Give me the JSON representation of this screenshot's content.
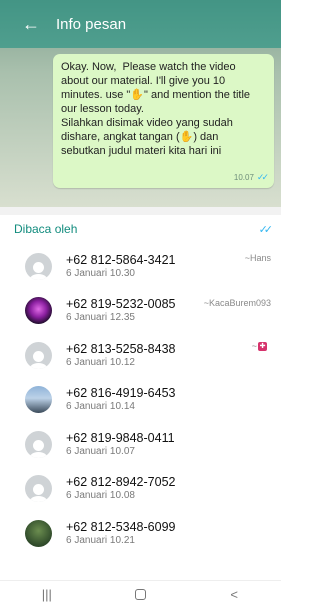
{
  "appbar": {
    "title": "Info pesan",
    "back_icon": "arrow-left-icon"
  },
  "message": {
    "text": "Okay. Now,  Please watch the video about our material. I'll give you 10 minutes. use \"✋\" and mention the title our lesson today.\nSilahkan disimak video yang sudah dishare, angkat tangan (✋) dan sebutkan judul materi kita hari ini",
    "time": "10.07",
    "status_icon": "double-check-icon"
  },
  "read_by": {
    "label": "Dibaca oleh",
    "status_icon": "double-check-icon",
    "color": "#34b7f1"
  },
  "readers": [
    {
      "phone": "+62 812-5864-3421",
      "date": "6 Januari 10.30",
      "alias": "~Hans",
      "avatar": "default-avatar-icon"
    },
    {
      "phone": "+62 819-5232-0085",
      "date": "6 Januari 12.35",
      "alias": "~KacaBurem093",
      "avatar": "profile-photo"
    },
    {
      "phone": "+62 813-5258-8438",
      "date": "6 Januari 10.12",
      "alias": "~",
      "avatar": "default-avatar-icon"
    },
    {
      "phone": "+62 816-4919-6453",
      "date": "6 Januari 10.14",
      "alias": "",
      "avatar": "profile-photo"
    },
    {
      "phone": "+62 819-9848-0411",
      "date": "6 Januari 10.07",
      "alias": "",
      "avatar": "default-avatar-icon"
    },
    {
      "phone": "+62 812-8942-7052",
      "date": "6 Januari 10.08",
      "alias": "",
      "avatar": "default-avatar-icon"
    },
    {
      "phone": "+62 812-5348-6099",
      "date": "6 Januari 10.21",
      "alias": "",
      "avatar": "profile-photo"
    }
  ],
  "navbar": {
    "recents_icon": "recent-apps-icon",
    "home_icon": "home-icon",
    "back_icon": "back-icon"
  }
}
